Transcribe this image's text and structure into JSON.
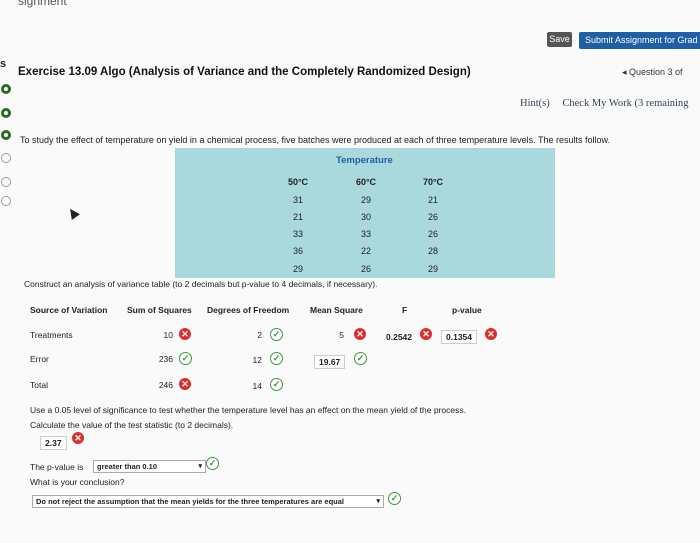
{
  "top_cut_text": "signment",
  "header": {
    "save_label": "Save",
    "submit_label": "Submit Assignment for Grad",
    "sidebar_letter": "s",
    "title": "Exercise 13.09 Algo (Analysis of Variance and the Completely Randomized Design)",
    "question_nav": "◂ Question 3 of",
    "hints_label": "Hint(s)",
    "check_label": "Check My Work (3 remaining"
  },
  "intro_text": "To study the effect of temperature on yield in a chemical process, five batches were produced at each of three temperature levels. The results follow.",
  "data_table": {
    "group_header": "Temperature",
    "columns": [
      "50°C",
      "60°C",
      "70°C"
    ],
    "rows": [
      [
        "31",
        "29",
        "21"
      ],
      [
        "21",
        "30",
        "26"
      ],
      [
        "33",
        "33",
        "26"
      ],
      [
        "36",
        "22",
        "28"
      ],
      [
        "29",
        "26",
        "29"
      ]
    ]
  },
  "construct_text": "Construct an analysis of variance table (to 2 decimals but p-value to 4 decimals, if necessary).",
  "anova": {
    "headers": [
      "Source of Variation",
      "Sum of Squares",
      "Degrees of Freedom",
      "Mean Square",
      "F",
      "p-value"
    ],
    "treatments": {
      "label": "Treatments",
      "ss": "10",
      "df": "2",
      "ms": "5",
      "f": "0.2542",
      "p": "0.1354"
    },
    "error": {
      "label": "Error",
      "ss": "236",
      "df": "12",
      "ms": "19.67"
    },
    "total": {
      "label": "Total",
      "ss": "246",
      "df": "14"
    }
  },
  "significance_text": "Use a 0.05 level of significance to test whether the temperature level has an effect on the mean yield of the process.",
  "calc_text": "Calculate the value of the test statistic (to 2 decimals).",
  "test_stat": "2.37",
  "pvalue_prefix": "The p-value is",
  "pvalue_select": "greater than 0.10",
  "conclusion_q": "What is your conclusion?",
  "conclusion_select": "Do not reject the assumption that the mean yields for the three temperatures are equal",
  "icons": {
    "wrong": "x-icon",
    "correct": "check-icon"
  },
  "colors": {
    "table_bg": "#a9d9dd",
    "submit": "#1f5fa6",
    "wrong": "#d9302c",
    "correct": "#3a9a3a"
  }
}
